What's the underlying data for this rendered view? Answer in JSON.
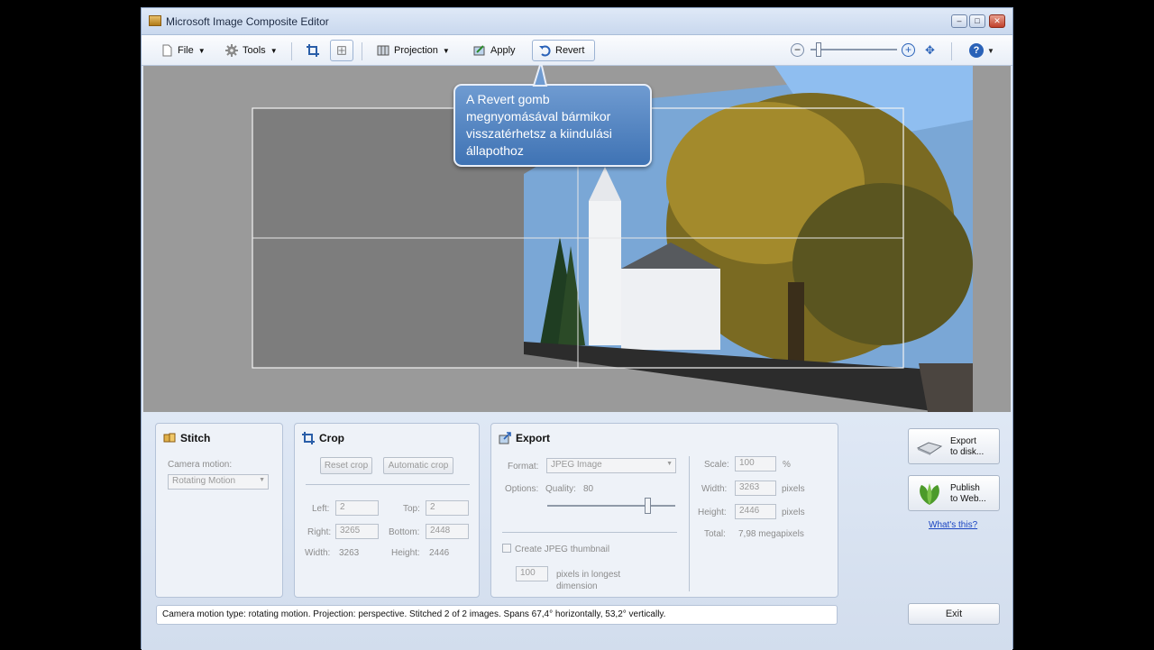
{
  "window": {
    "title": "Microsoft Image Composite Editor"
  },
  "toolbar": {
    "file": "File",
    "tools": "Tools",
    "projection": "Projection",
    "apply": "Apply",
    "revert": "Revert"
  },
  "callout": {
    "lines": [
      "A Revert gomb",
      "megnyomásával bármikor",
      "visszatérhetsz a kiindulási",
      "állapothoz"
    ]
  },
  "stitch": {
    "title": "Stitch",
    "camera_motion_label": "Camera motion:",
    "camera_motion_value": "Rotating Motion"
  },
  "crop": {
    "title": "Crop",
    "reset_crop": "Reset crop",
    "automatic_crop": "Automatic crop",
    "left_label": "Left:",
    "left_value": "2",
    "top_label": "Top:",
    "top_value": "2",
    "right_label": "Right:",
    "right_value": "3265",
    "bottom_label": "Bottom:",
    "bottom_value": "2448",
    "width_label": "Width:",
    "width_value": "3263",
    "height_label": "Height:",
    "height_value": "2446"
  },
  "export": {
    "title": "Export",
    "format_label": "Format:",
    "format_value": "JPEG Image",
    "options_label": "Options:",
    "quality_label": "Quality:",
    "quality_value": "80",
    "quality_level": 0.78,
    "thumbnail_label": "Create JPEG thumbnail",
    "thumb_value": "100",
    "thumb_unit_1": "pixels in longest",
    "thumb_unit_2": "dimension",
    "scale_label": "Scale:",
    "scale_value": "100",
    "scale_unit": "%",
    "width_label": "Width:",
    "width_value": "3263",
    "width_unit": "pixels",
    "height_label": "Height:",
    "height_value": "2446",
    "height_unit": "pixels",
    "total_label": "Total:",
    "total_value": "7,98 megapixels"
  },
  "actions": {
    "export_line1": "Export",
    "export_line2": "to disk...",
    "publish_line1": "Publish",
    "publish_line2": "to Web...",
    "whats_this": "What's this?",
    "exit": "Exit"
  },
  "status": {
    "text": "Camera motion type: rotating motion. Projection: perspective. Stitched 2 of 2 images. Spans 67,4° horizontally, 53,2° vertically."
  }
}
